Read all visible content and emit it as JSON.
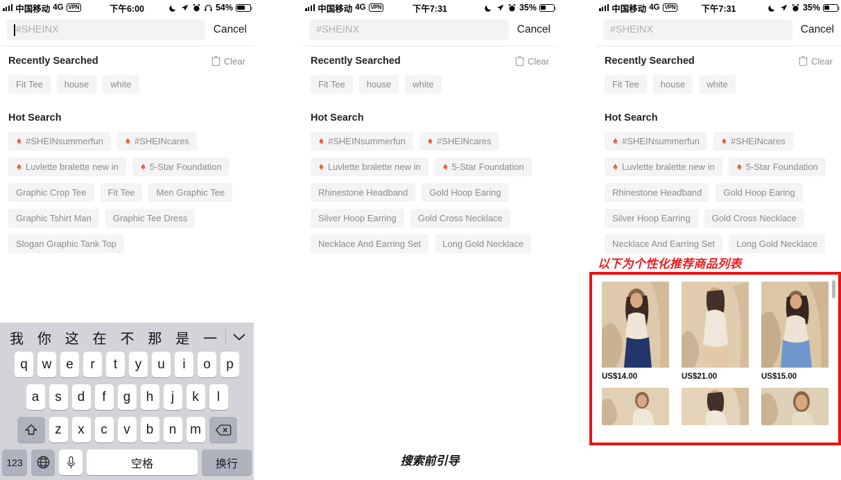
{
  "panels": [
    {
      "id": "left",
      "status": {
        "signal_icon": "signal-bars-icon",
        "carrier": "中国移动",
        "network": "4G",
        "vpn": "VPN",
        "time": "下午6:00",
        "moon_icon": "moon-icon",
        "location_icon": "location-arrow-icon",
        "alarm_icon": "alarm-clock-icon",
        "headphones_icon": "headphones-icon",
        "battery_pct": "54%",
        "battery_icon": "battery-icon"
      },
      "search": {
        "placeholder": "#SHEINX",
        "value": "",
        "cancel": "Cancel",
        "focused": true
      },
      "recent": {
        "title": "Recently Searched",
        "clear": "Clear",
        "clear_icon": "trash-icon",
        "chips": [
          "Fit Tee",
          "house",
          "white"
        ]
      },
      "hot": {
        "title": "Hot Search",
        "rows": [
          [
            {
              "label": "#SHEINsummerfun",
              "flame": true
            },
            {
              "label": "#SHEINcares",
              "flame": true
            }
          ],
          [
            {
              "label": "Luvlette bralette new in",
              "flame": true
            },
            {
              "label": "5-Star Foundation",
              "flame": true
            }
          ],
          [
            {
              "label": "Graphic Crop Tee",
              "flame": false
            },
            {
              "label": "Fit Tee",
              "flame": false
            },
            {
              "label": "Men Graphic Tee",
              "flame": false
            }
          ],
          [
            {
              "label": "Graphic Tshirt Man",
              "flame": false
            },
            {
              "label": "Graphic Tee Dress",
              "flame": false
            }
          ],
          [
            {
              "label": "Slogan Graphic Tank Top",
              "flame": false
            }
          ]
        ]
      },
      "keyboard": {
        "predictions": [
          "我",
          "你",
          "这",
          "在",
          "不",
          "那",
          "是",
          "一"
        ],
        "collapse_icon": "chevron-down-icon",
        "row1": [
          "q",
          "w",
          "e",
          "r",
          "t",
          "y",
          "u",
          "i",
          "o",
          "p"
        ],
        "row2": [
          "a",
          "s",
          "d",
          "f",
          "g",
          "h",
          "j",
          "k",
          "l"
        ],
        "row3": [
          "z",
          "x",
          "c",
          "v",
          "b",
          "n",
          "m"
        ],
        "shift_icon": "shift-arrow-icon",
        "backspace_icon": "backspace-icon",
        "numeric": "123",
        "globe_icon": "globe-icon",
        "mic_icon": "microphone-icon",
        "space": "空格",
        "return": "换行"
      }
    },
    {
      "id": "mid",
      "status": {
        "signal_icon": "signal-bars-icon",
        "carrier": "中国移动",
        "network": "4G",
        "vpn": "VPN",
        "time": "下午7:31",
        "moon_icon": "moon-icon",
        "location_icon": "location-arrow-icon",
        "alarm_icon": "alarm-clock-icon",
        "battery_pct": "35%",
        "battery_icon": "battery-icon"
      },
      "search": {
        "placeholder": "#SHEINX",
        "value": "",
        "cancel": "Cancel",
        "focused": false
      },
      "recent": {
        "title": "Recently Searched",
        "clear": "Clear",
        "clear_icon": "trash-icon",
        "chips": [
          "Fit Tee",
          "house",
          "white"
        ]
      },
      "hot": {
        "title": "Hot Search",
        "rows": [
          [
            {
              "label": "#SHEINsummerfun",
              "flame": true
            },
            {
              "label": "#SHEINcares",
              "flame": true
            }
          ],
          [
            {
              "label": "Luvlette bralette new in",
              "flame": true
            },
            {
              "label": "5-Star Foundation",
              "flame": true
            }
          ],
          [
            {
              "label": "Rhinestone Headband",
              "flame": false
            },
            {
              "label": "Gold Hoop Earing",
              "flame": false
            }
          ],
          [
            {
              "label": "Silver Hoop Earring",
              "flame": false
            },
            {
              "label": "Gold Cross Necklace",
              "flame": false
            }
          ],
          [
            {
              "label": "Necklace And Earring Set",
              "flame": false
            },
            {
              "label": "Long Gold Necklace",
              "flame": false
            }
          ]
        ]
      },
      "caption": "搜索前引导"
    },
    {
      "id": "right",
      "status": {
        "signal_icon": "signal-bars-icon",
        "carrier": "中国移动",
        "network": "4G",
        "vpn": "VPN",
        "time": "下午7:31",
        "moon_icon": "moon-icon",
        "location_icon": "location-arrow-icon",
        "alarm_icon": "alarm-clock-icon",
        "battery_pct": "35%",
        "battery_icon": "battery-icon"
      },
      "search": {
        "placeholder": "#SHEINX",
        "value": "",
        "cancel": "Cancel",
        "focused": false
      },
      "recent": {
        "title": "Recently Searched",
        "clear": "Clear",
        "clear_icon": "trash-icon",
        "chips": [
          "Fit Tee",
          "house",
          "white"
        ]
      },
      "hot": {
        "title": "Hot Search",
        "rows": [
          [
            {
              "label": "#SHEINsummerfun",
              "flame": true
            },
            {
              "label": "#SHEINcares",
              "flame": true
            }
          ],
          [
            {
              "label": "Luvlette bralette new in",
              "flame": true
            },
            {
              "label": "5-Star Foundation",
              "flame": true
            }
          ],
          [
            {
              "label": "Rhinestone Headband",
              "flame": false
            },
            {
              "label": "Gold Hoop Earing",
              "flame": false
            }
          ],
          [
            {
              "label": "Silver Hoop Earring",
              "flame": false
            },
            {
              "label": "Gold Cross Necklace",
              "flame": false
            }
          ],
          [
            {
              "label": "Necklace And Earring Set",
              "flame": false
            },
            {
              "label": "Long Gold Necklace",
              "flame": false
            }
          ]
        ]
      },
      "annotation": "以下为个性化推荐商品列表",
      "products": [
        {
          "price": "US$14.00"
        },
        {
          "price": "US$21.00"
        },
        {
          "price": "US$15.00"
        }
      ],
      "products_row2": [
        {
          "price": ""
        },
        {
          "price": ""
        },
        {
          "price": ""
        }
      ]
    }
  ],
  "colors": {
    "annotation_red": "#ee1c1c",
    "flame_red": "#e8503a",
    "chip_bg": "#f4f4f4",
    "chip_text": "#8b8b8b"
  }
}
